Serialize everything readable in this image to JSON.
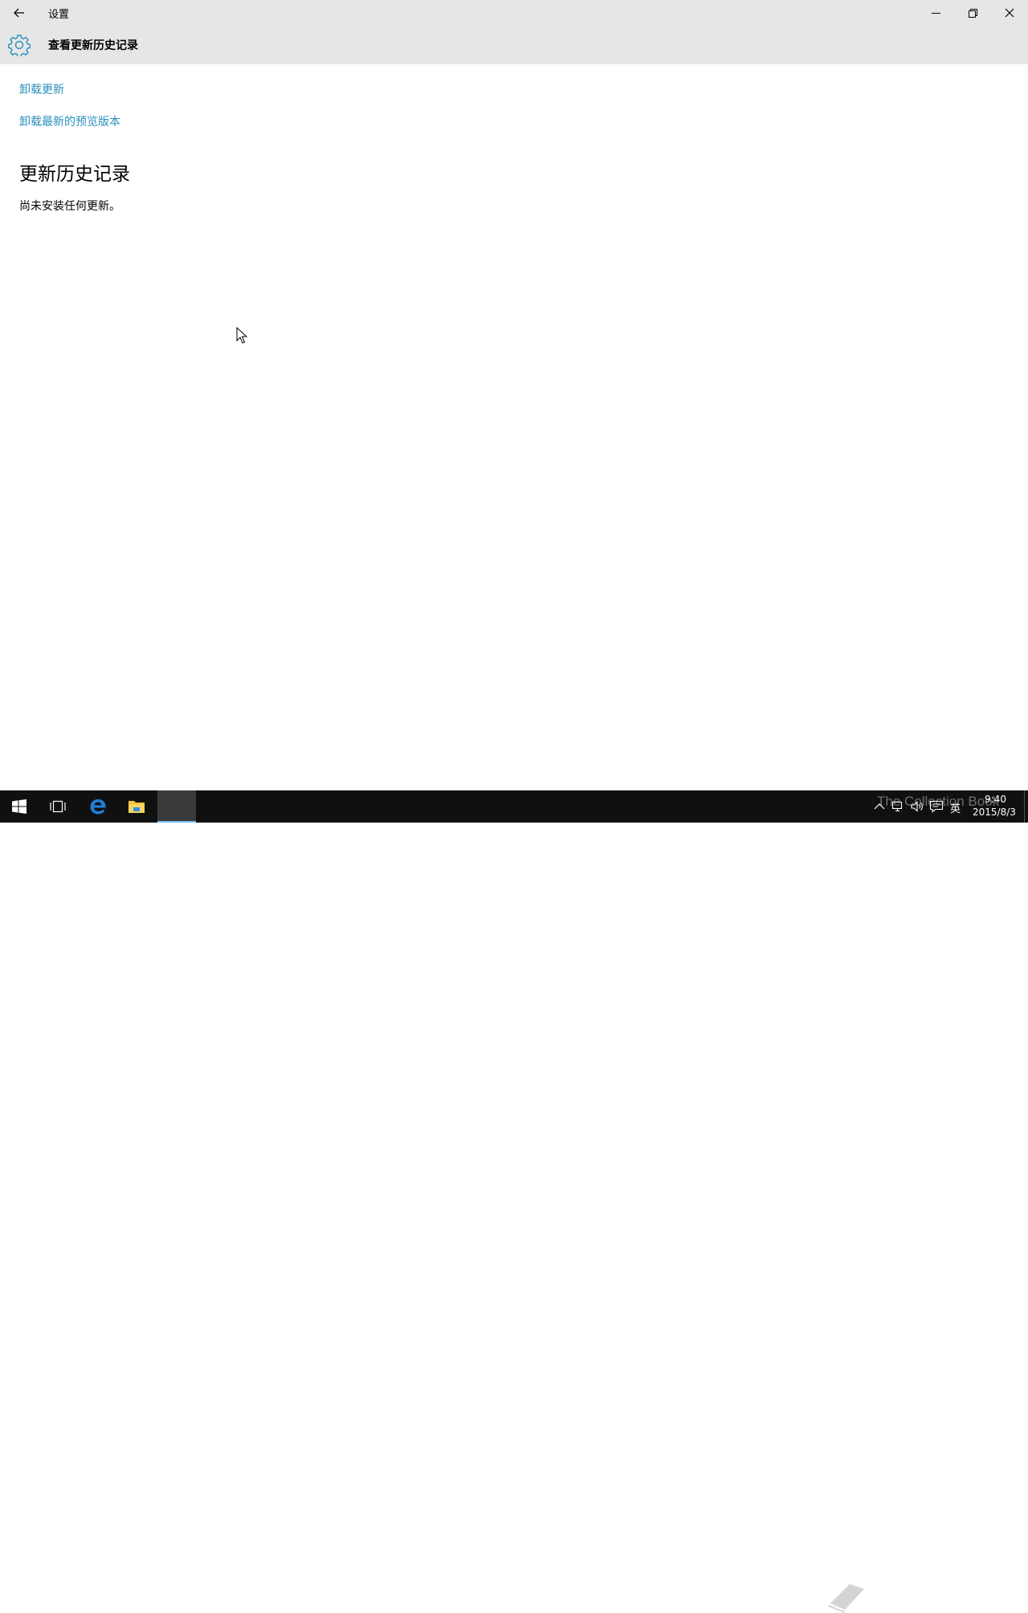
{
  "window": {
    "app_title": "设置",
    "page_title": "查看更新历史记录"
  },
  "links": {
    "uninstall_updates": "卸载更新",
    "uninstall_preview": "卸载最新的预览版本"
  },
  "history": {
    "heading": "更新历史记录",
    "empty_text": "尚未安装任何更新。"
  },
  "taskbar": {
    "input_language": "英",
    "time": "9:40",
    "date": "2015/8/3",
    "watermark": "The Collection Book"
  },
  "colors": {
    "accent_link": "#2a8fbd",
    "titlebar": "#e6e6e6",
    "taskbar": "#101010"
  },
  "icons": {
    "back": "back-arrow-icon",
    "gear": "gear-icon",
    "start": "windows-start-icon",
    "task_view": "task-view-icon",
    "edge": "edge-icon",
    "explorer": "file-explorer-icon"
  }
}
